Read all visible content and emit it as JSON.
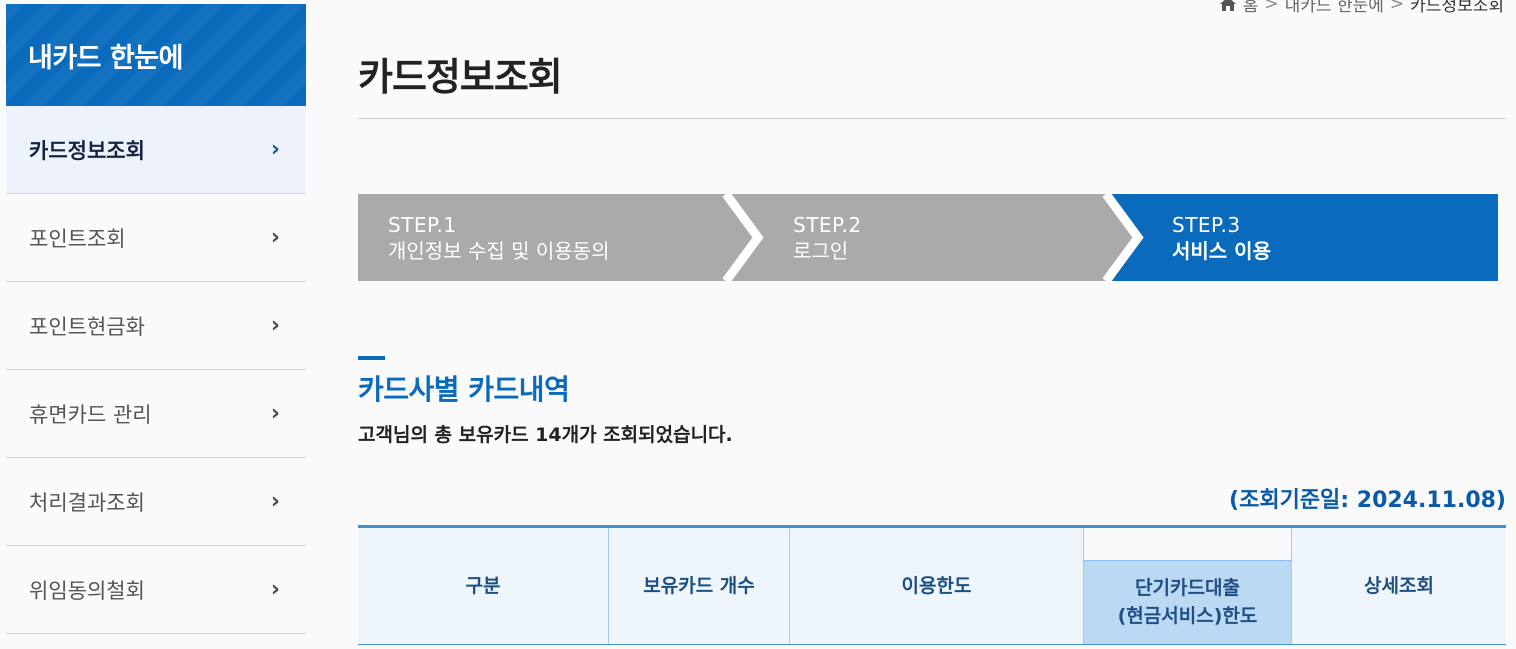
{
  "sidebar": {
    "title": "내카드 한눈에",
    "items": [
      {
        "label": "카드정보조회",
        "active": true
      },
      {
        "label": "포인트조회"
      },
      {
        "label": "포인트현금화"
      },
      {
        "label": "휴면카드 관리"
      },
      {
        "label": "처리결과조회"
      },
      {
        "label": "위임동의철회"
      }
    ]
  },
  "breadcrumb": {
    "home": "홈",
    "level1": "내카드 한눈에",
    "current": "카드정보조회"
  },
  "page": {
    "title": "카드정보조회"
  },
  "steps": [
    {
      "label": "STEP.1",
      "desc": "개인정보 수집 및 이용동의"
    },
    {
      "label": "STEP.2",
      "desc": "로그인"
    },
    {
      "label": "STEP.3",
      "desc": "서비스 이용",
      "active": true
    }
  ],
  "section": {
    "title": "카드사별 카드내역",
    "subtitle": "고객님의 총 보유카드 14개가 조회되었습니다.",
    "ref_date": "(조회기준일: 2024.11.08)"
  },
  "table": {
    "headers": [
      "구분",
      "보유카드 개수",
      "이용한도",
      "단기카드대출",
      "(현금서비스)한도",
      "상세조회"
    ]
  },
  "colors": {
    "accent": "#0a6bbd",
    "step_inactive": "#aaaaaa",
    "header_highlight": "#bcd9f3"
  }
}
